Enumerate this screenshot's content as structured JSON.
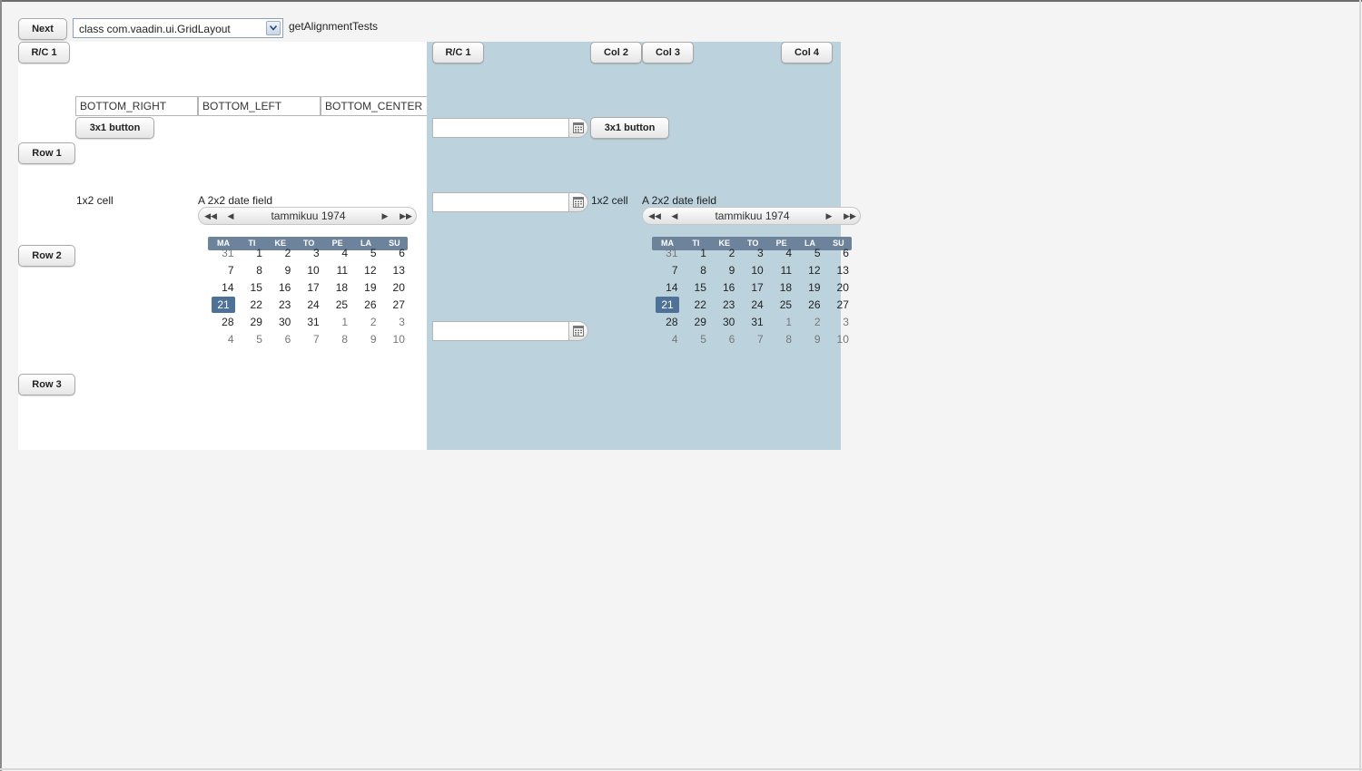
{
  "toolbar": {
    "next_label": "Next",
    "class_select_value": "class com.vaadin.ui.GridLayout",
    "test_name": "getAlignmentTests"
  },
  "left_grid": {
    "rc_label": "R/C 1",
    "row1_label": "Row 1",
    "row2_label": "Row 2",
    "row3_label": "Row 3",
    "fields": [
      "BOTTOM_RIGHT",
      "BOTTOM_LEFT",
      "BOTTOM_CENTER"
    ],
    "button_3x1": "3x1 button",
    "cell_1x2": "1x2 cell",
    "date_caption": "A 2x2 date field"
  },
  "right_grid": {
    "rc_label": "R/C 1",
    "col2_label": "Col 2",
    "col3_label": "Col 3",
    "col4_label": "Col 4",
    "button_3x1": "3x1 button",
    "cell_1x2": "1x2 cell",
    "date_caption": "A 2x2 date field"
  },
  "calendar": {
    "month_year": "tammikuu 1974",
    "weekdays": [
      "MA",
      "TI",
      "KE",
      "TO",
      "PE",
      "LA",
      "SU"
    ],
    "weeks": [
      [
        "31",
        "1",
        "2",
        "3",
        "4",
        "5",
        "6"
      ],
      [
        "7",
        "8",
        "9",
        "10",
        "11",
        "12",
        "13"
      ],
      [
        "14",
        "15",
        "16",
        "17",
        "18",
        "19",
        "20"
      ],
      [
        "21",
        "22",
        "23",
        "24",
        "25",
        "26",
        "27"
      ],
      [
        "28",
        "29",
        "30",
        "31",
        "1",
        "2",
        "3"
      ],
      [
        "4",
        "5",
        "6",
        "7",
        "8",
        "9",
        "10"
      ]
    ],
    "selected_day": "21",
    "nav": {
      "prev_year": "◀◀",
      "prev_month": "◀",
      "next_month": "▶",
      "next_year": "▶▶"
    }
  },
  "colors": {
    "right_grid_bg": "#bcd2dc",
    "weekday_bar": "#6d839c",
    "selected_day": "#4d7197"
  }
}
